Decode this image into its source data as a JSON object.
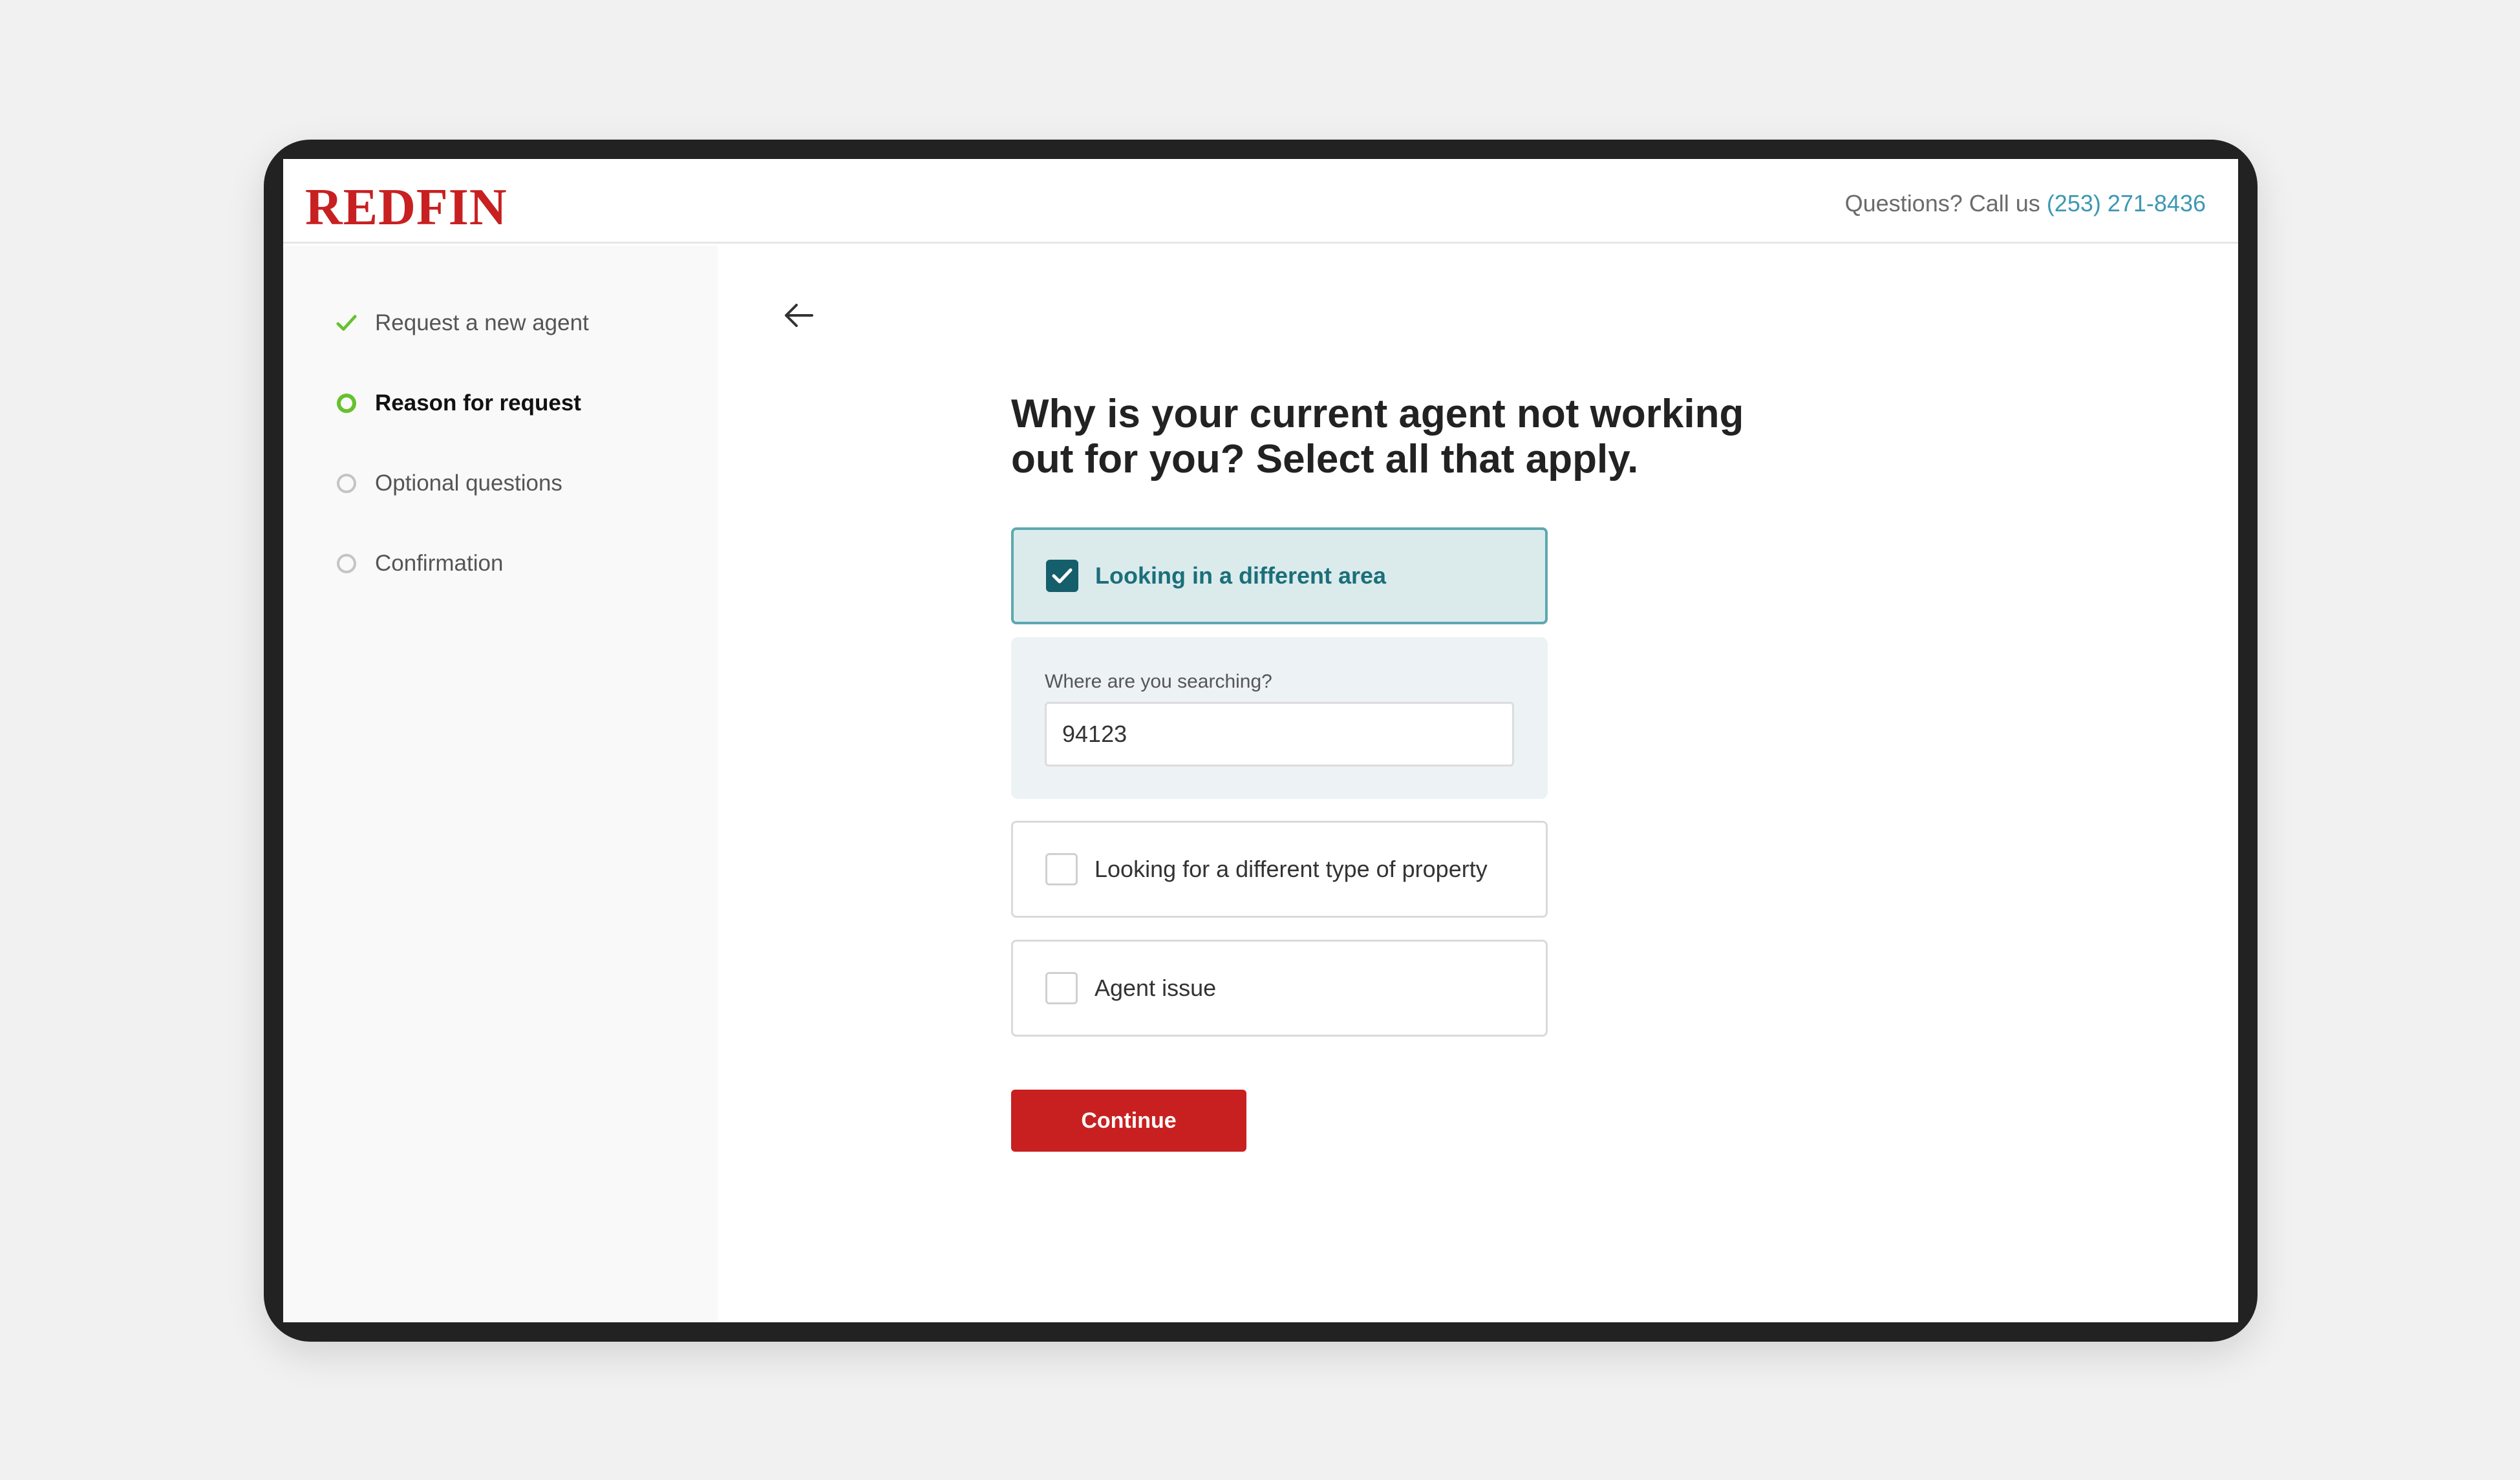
{
  "brand": {
    "logo_text": "REDFIN",
    "accent": "#c82021"
  },
  "header": {
    "help_text": "Questions? Call us",
    "phone": "(253) 271-8436"
  },
  "steps": [
    {
      "label": "Request a new agent",
      "state": "completed",
      "icon": "check-icon"
    },
    {
      "label": "Reason for request",
      "state": "active",
      "icon": "circle-icon"
    },
    {
      "label": "Optional questions",
      "state": "pending",
      "icon": "circle-icon"
    },
    {
      "label": "Confirmation",
      "state": "pending",
      "icon": "circle-icon"
    }
  ],
  "main": {
    "back_icon": "arrow-left-icon",
    "question_line1": "Why is your current agent not working",
    "question_line2": "out for you? Select all that apply.",
    "options": [
      {
        "label": "Looking in a different area",
        "checked": true
      },
      {
        "label": "Looking for a different type of property",
        "checked": false
      },
      {
        "label": "Agent issue",
        "checked": false
      }
    ],
    "location": {
      "label": "Where are you searching?",
      "value": "94123"
    },
    "continue_label": "Continue"
  }
}
